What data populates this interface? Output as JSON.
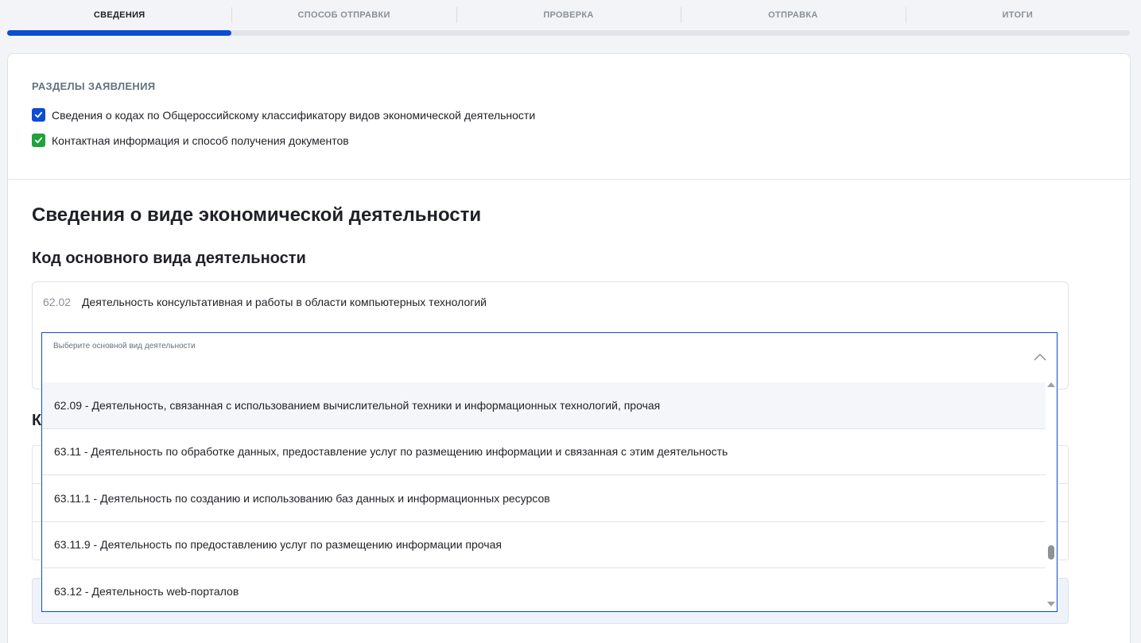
{
  "stepper": {
    "steps": [
      "СВЕДЕНИЯ",
      "СПОСОБ ОТПРАВКИ",
      "ПРОВЕРКА",
      "ОТПРАВКА",
      "ИТОГИ"
    ],
    "active_index": 0,
    "progress": 0.2
  },
  "sections": {
    "title": "РАЗДЕЛЫ ЗАЯВЛЕНИЯ",
    "items": [
      {
        "label": "Сведения о кодах по Общероссийскому классификатору видов экономической деятельности",
        "checked": true,
        "color": "#0d4cd3"
      },
      {
        "label": "Контактная информация и способ получения документов",
        "checked": true,
        "color": "#1fa33b"
      }
    ]
  },
  "main": {
    "title": "Сведения о виде экономической деятельности",
    "subtitle": "Код основного вида деятельности",
    "current": {
      "code": "62.02",
      "name": "Деятельность консультативная и работы в области компьютерных технологий"
    },
    "second_heading_visible": "К"
  },
  "select": {
    "label": "Выберите основной вид деятельности",
    "options": [
      "62.09 - Деятельность, связанная с использованием вычислительной техники и информационных технологий, прочая",
      "63.11 - Деятельность по обработке данных, предоставление услуг по размещению информации и связанная с этим деятельность",
      "63.11.1 - Деятельность по созданию и использованию баз данных и информационных ресурсов",
      "63.11.9 - Деятельность по предоставлению услуг по размещению информации прочая",
      "63.12 - Деятельность web-порталов"
    ],
    "hovered_index": 0
  },
  "colors": {
    "accent": "#0d4cd3",
    "success": "#1fa33b"
  }
}
